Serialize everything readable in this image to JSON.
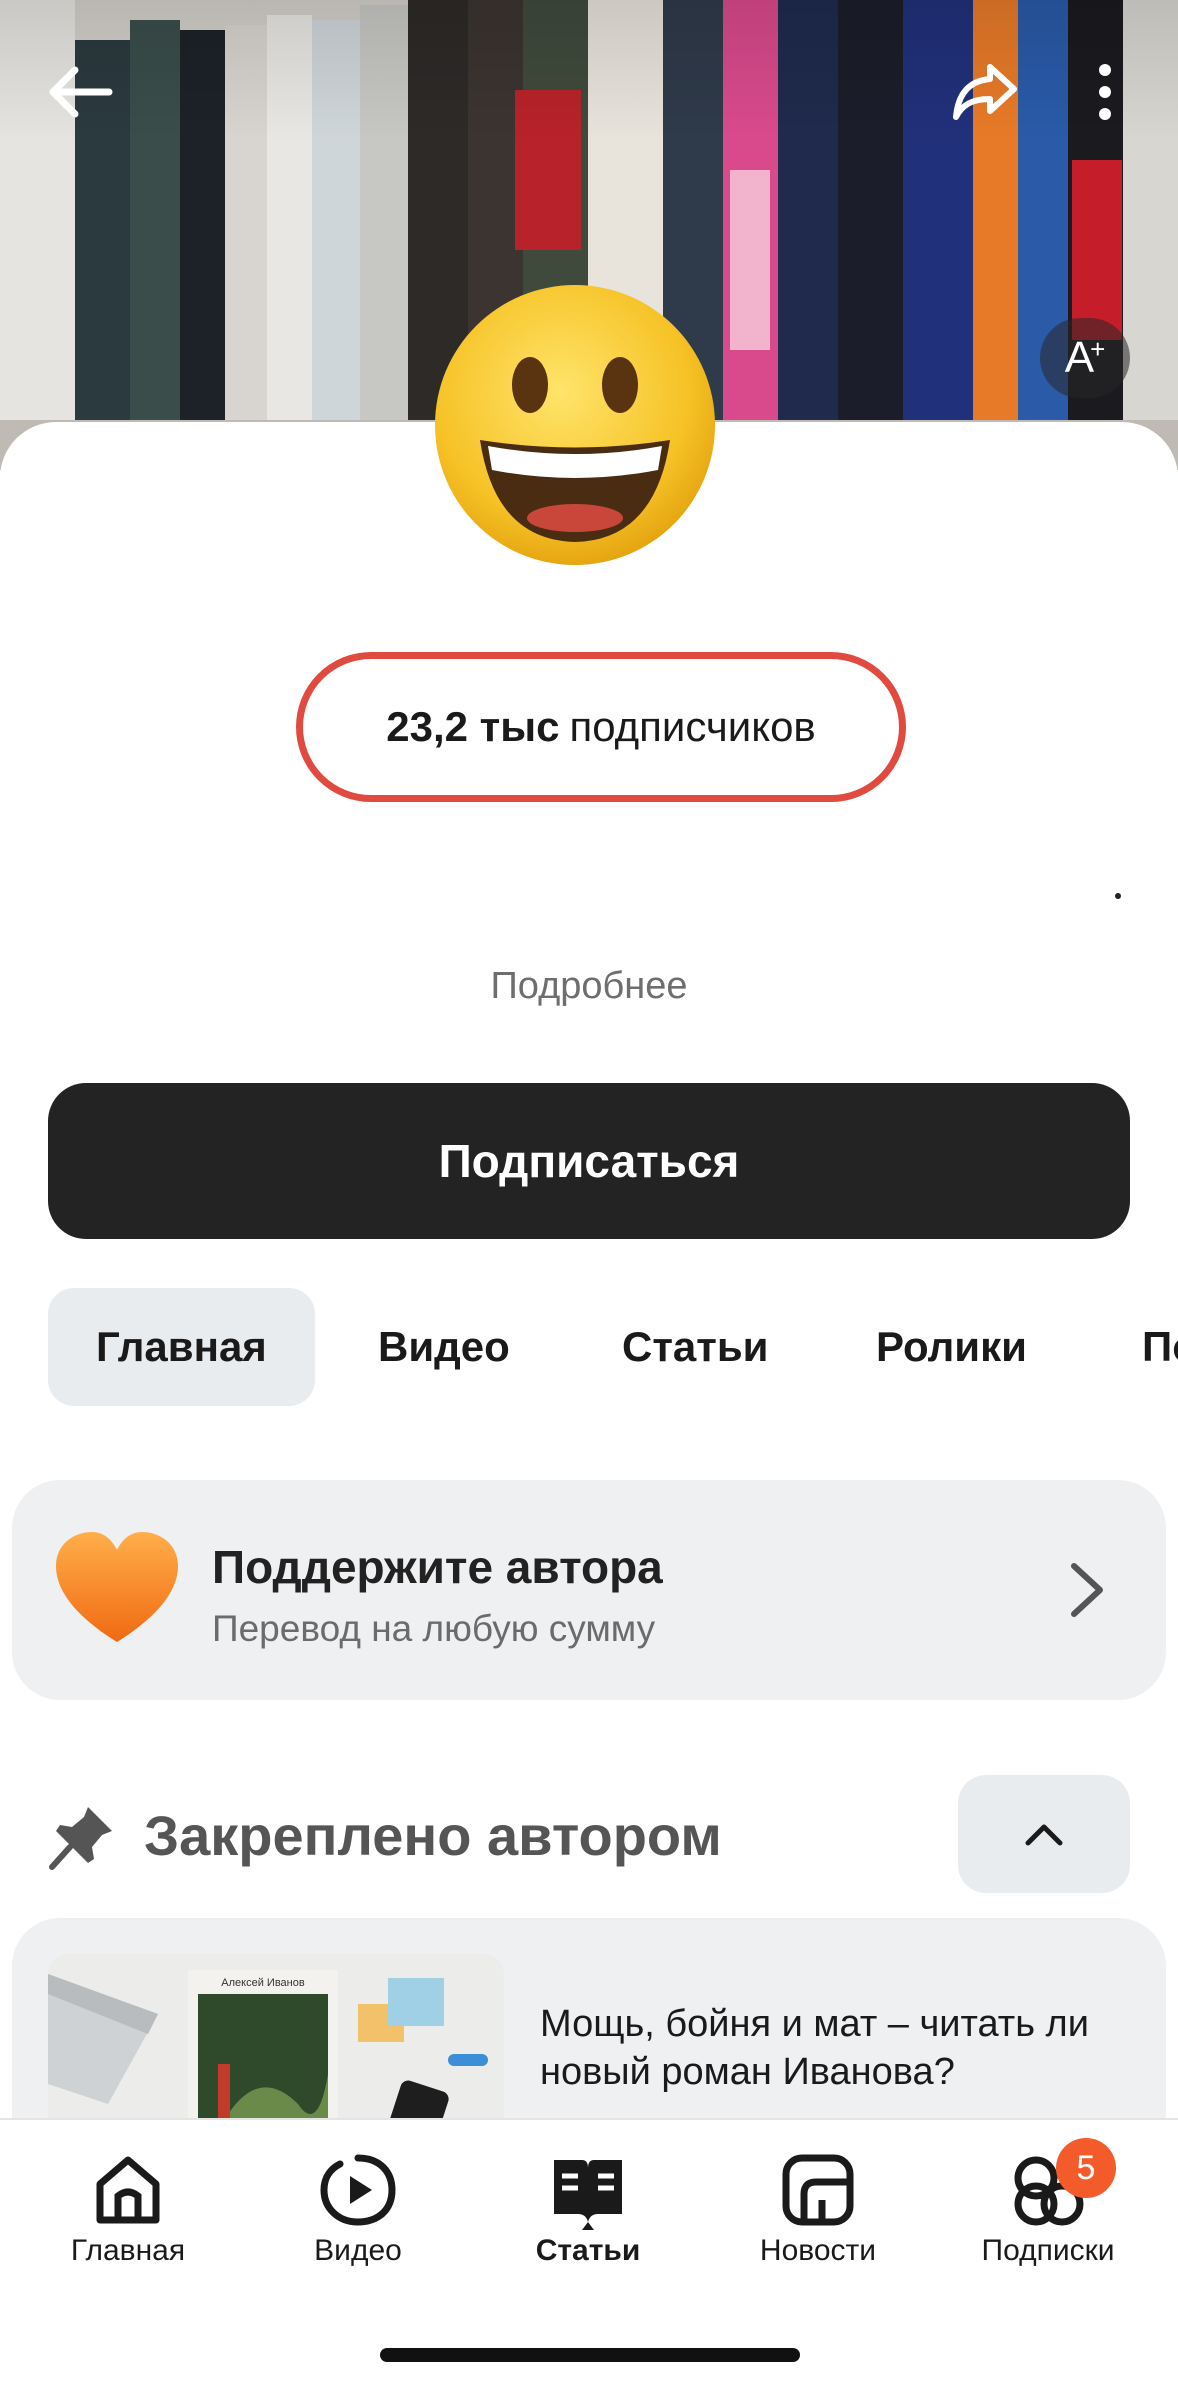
{
  "cover": {
    "font_button_label": "A",
    "font_button_sup": "+"
  },
  "profile": {
    "subscribers_count": "23,2 тыс",
    "subscribers_label": "подписчиков",
    "more_link": "Подробнее",
    "subscribe_button": "Подписаться"
  },
  "tabs": [
    {
      "label": "Главная",
      "active": true
    },
    {
      "label": "Видео",
      "active": false
    },
    {
      "label": "Статьи",
      "active": false
    },
    {
      "label": "Ролики",
      "active": false
    },
    {
      "label": "По",
      "active": false
    }
  ],
  "support": {
    "title": "Поддержите автора",
    "subtitle": "Перевод на любую сумму"
  },
  "pinned": {
    "header": "Закреплено автором",
    "article_title": "Мощь, бойня и мат – читать ли новый роман Иванова?",
    "thumb_book_author": "Алексей Иванов"
  },
  "bottom_nav": [
    {
      "label": "Главная",
      "icon": "home-icon",
      "active": false
    },
    {
      "label": "Видео",
      "icon": "video-icon",
      "active": false
    },
    {
      "label": "Статьи",
      "icon": "articles-icon",
      "active": true
    },
    {
      "label": "Новости",
      "icon": "news-icon",
      "active": false
    },
    {
      "label": "Подписки",
      "icon": "subscriptions-icon",
      "active": false
    }
  ],
  "subscriptions_badge": "5",
  "colors": {
    "accent_red": "#e04a3f",
    "button_dark": "#232323",
    "badge_orange": "#f35b2a"
  }
}
